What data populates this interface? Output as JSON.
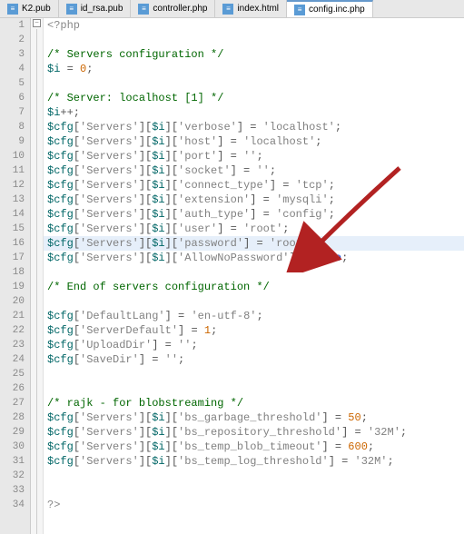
{
  "tabs": [
    {
      "label": "K2.pub",
      "active": false
    },
    {
      "label": "id_rsa.pub",
      "active": false
    },
    {
      "label": "controller.php",
      "active": false
    },
    {
      "label": "index.html",
      "active": false
    },
    {
      "label": "config.inc.php",
      "active": true
    }
  ],
  "gutter": {
    "start": 1,
    "end": 34
  },
  "fold_marker": "−",
  "code_lines": [
    [
      [
        "kw-tag",
        "<?php"
      ]
    ],
    [],
    [
      [
        "kw-cmt",
        "/* Servers configuration */"
      ]
    ],
    [
      [
        "kw-var",
        "$i"
      ],
      [
        "kw-op",
        " = "
      ],
      [
        "kw-num",
        "0"
      ],
      [
        "kw-op",
        ";"
      ]
    ],
    [],
    [
      [
        "kw-cmt",
        "/* Server: localhost [1] */"
      ]
    ],
    [
      [
        "kw-var",
        "$i"
      ],
      [
        "kw-op",
        "++;"
      ]
    ],
    [
      [
        "kw-var",
        "$cfg"
      ],
      [
        "kw-op",
        "["
      ],
      [
        "kw-str",
        "'Servers'"
      ],
      [
        "kw-op",
        "]["
      ],
      [
        "kw-var",
        "$i"
      ],
      [
        "kw-op",
        "]["
      ],
      [
        "kw-str",
        "'verbose'"
      ],
      [
        "kw-op",
        "] = "
      ],
      [
        "kw-str",
        "'localhost'"
      ],
      [
        "kw-op",
        ";"
      ]
    ],
    [
      [
        "kw-var",
        "$cfg"
      ],
      [
        "kw-op",
        "["
      ],
      [
        "kw-str",
        "'Servers'"
      ],
      [
        "kw-op",
        "]["
      ],
      [
        "kw-var",
        "$i"
      ],
      [
        "kw-op",
        "]["
      ],
      [
        "kw-str",
        "'host'"
      ],
      [
        "kw-op",
        "] = "
      ],
      [
        "kw-str",
        "'localhost'"
      ],
      [
        "kw-op",
        ";"
      ]
    ],
    [
      [
        "kw-var",
        "$cfg"
      ],
      [
        "kw-op",
        "["
      ],
      [
        "kw-str",
        "'Servers'"
      ],
      [
        "kw-op",
        "]["
      ],
      [
        "kw-var",
        "$i"
      ],
      [
        "kw-op",
        "]["
      ],
      [
        "kw-str",
        "'port'"
      ],
      [
        "kw-op",
        "] = "
      ],
      [
        "kw-str",
        "''"
      ],
      [
        "kw-op",
        ";"
      ]
    ],
    [
      [
        "kw-var",
        "$cfg"
      ],
      [
        "kw-op",
        "["
      ],
      [
        "kw-str",
        "'Servers'"
      ],
      [
        "kw-op",
        "]["
      ],
      [
        "kw-var",
        "$i"
      ],
      [
        "kw-op",
        "]["
      ],
      [
        "kw-str",
        "'socket'"
      ],
      [
        "kw-op",
        "] = "
      ],
      [
        "kw-str",
        "''"
      ],
      [
        "kw-op",
        ";"
      ]
    ],
    [
      [
        "kw-var",
        "$cfg"
      ],
      [
        "kw-op",
        "["
      ],
      [
        "kw-str",
        "'Servers'"
      ],
      [
        "kw-op",
        "]["
      ],
      [
        "kw-var",
        "$i"
      ],
      [
        "kw-op",
        "]["
      ],
      [
        "kw-str",
        "'connect_type'"
      ],
      [
        "kw-op",
        "] = "
      ],
      [
        "kw-str",
        "'tcp'"
      ],
      [
        "kw-op",
        ";"
      ]
    ],
    [
      [
        "kw-var",
        "$cfg"
      ],
      [
        "kw-op",
        "["
      ],
      [
        "kw-str",
        "'Servers'"
      ],
      [
        "kw-op",
        "]["
      ],
      [
        "kw-var",
        "$i"
      ],
      [
        "kw-op",
        "]["
      ],
      [
        "kw-str",
        "'extension'"
      ],
      [
        "kw-op",
        "] = "
      ],
      [
        "kw-str",
        "'mysqli'"
      ],
      [
        "kw-op",
        ";"
      ]
    ],
    [
      [
        "kw-var",
        "$cfg"
      ],
      [
        "kw-op",
        "["
      ],
      [
        "kw-str",
        "'Servers'"
      ],
      [
        "kw-op",
        "]["
      ],
      [
        "kw-var",
        "$i"
      ],
      [
        "kw-op",
        "]["
      ],
      [
        "kw-str",
        "'auth_type'"
      ],
      [
        "kw-op",
        "] = "
      ],
      [
        "kw-str",
        "'config'"
      ],
      [
        "kw-op",
        ";"
      ]
    ],
    [
      [
        "kw-var",
        "$cfg"
      ],
      [
        "kw-op",
        "["
      ],
      [
        "kw-str",
        "'Servers'"
      ],
      [
        "kw-op",
        "]["
      ],
      [
        "kw-var",
        "$i"
      ],
      [
        "kw-op",
        "]["
      ],
      [
        "kw-str",
        "'user'"
      ],
      [
        "kw-op",
        "] = "
      ],
      [
        "kw-str",
        "'root'"
      ],
      [
        "kw-op",
        ";"
      ]
    ],
    [
      [
        "kw-var",
        "$cfg"
      ],
      [
        "kw-op",
        "["
      ],
      [
        "kw-str",
        "'Servers'"
      ],
      [
        "kw-op",
        "]["
      ],
      [
        "kw-var",
        "$i"
      ],
      [
        "kw-op",
        "]["
      ],
      [
        "kw-str",
        "'password'"
      ],
      [
        "kw-op",
        "] = "
      ],
      [
        "kw-str",
        "'root'"
      ],
      [
        "kw-op",
        ";"
      ]
    ],
    [
      [
        "kw-var",
        "$cfg"
      ],
      [
        "kw-op",
        "["
      ],
      [
        "kw-str",
        "'Servers'"
      ],
      [
        "kw-op",
        "]["
      ],
      [
        "kw-var",
        "$i"
      ],
      [
        "kw-op",
        "]["
      ],
      [
        "kw-str",
        "'AllowNoPassword'"
      ],
      [
        "kw-op",
        "] = "
      ],
      [
        "kw-bool",
        "true"
      ],
      [
        "kw-op",
        ";"
      ]
    ],
    [],
    [
      [
        "kw-cmt",
        "/* End of servers configuration */"
      ]
    ],
    [],
    [
      [
        "kw-var",
        "$cfg"
      ],
      [
        "kw-op",
        "["
      ],
      [
        "kw-str",
        "'DefaultLang'"
      ],
      [
        "kw-op",
        "] = "
      ],
      [
        "kw-str",
        "'en-utf-8'"
      ],
      [
        "kw-op",
        ";"
      ]
    ],
    [
      [
        "kw-var",
        "$cfg"
      ],
      [
        "kw-op",
        "["
      ],
      [
        "kw-str",
        "'ServerDefault'"
      ],
      [
        "kw-op",
        "] = "
      ],
      [
        "kw-num",
        "1"
      ],
      [
        "kw-op",
        ";"
      ]
    ],
    [
      [
        "kw-var",
        "$cfg"
      ],
      [
        "kw-op",
        "["
      ],
      [
        "kw-str",
        "'UploadDir'"
      ],
      [
        "kw-op",
        "] = "
      ],
      [
        "kw-str",
        "''"
      ],
      [
        "kw-op",
        ";"
      ]
    ],
    [
      [
        "kw-var",
        "$cfg"
      ],
      [
        "kw-op",
        "["
      ],
      [
        "kw-str",
        "'SaveDir'"
      ],
      [
        "kw-op",
        "] = "
      ],
      [
        "kw-str",
        "''"
      ],
      [
        "kw-op",
        ";"
      ]
    ],
    [],
    [],
    [
      [
        "kw-cmt",
        "/* rajk - for blobstreaming */"
      ]
    ],
    [
      [
        "kw-var",
        "$cfg"
      ],
      [
        "kw-op",
        "["
      ],
      [
        "kw-str",
        "'Servers'"
      ],
      [
        "kw-op",
        "]["
      ],
      [
        "kw-var",
        "$i"
      ],
      [
        "kw-op",
        "]["
      ],
      [
        "kw-str",
        "'bs_garbage_threshold'"
      ],
      [
        "kw-op",
        "] = "
      ],
      [
        "kw-num",
        "50"
      ],
      [
        "kw-op",
        ";"
      ]
    ],
    [
      [
        "kw-var",
        "$cfg"
      ],
      [
        "kw-op",
        "["
      ],
      [
        "kw-str",
        "'Servers'"
      ],
      [
        "kw-op",
        "]["
      ],
      [
        "kw-var",
        "$i"
      ],
      [
        "kw-op",
        "]["
      ],
      [
        "kw-str",
        "'bs_repository_threshold'"
      ],
      [
        "kw-op",
        "] = "
      ],
      [
        "kw-str",
        "'32M'"
      ],
      [
        "kw-op",
        ";"
      ]
    ],
    [
      [
        "kw-var",
        "$cfg"
      ],
      [
        "kw-op",
        "["
      ],
      [
        "kw-str",
        "'Servers'"
      ],
      [
        "kw-op",
        "]["
      ],
      [
        "kw-var",
        "$i"
      ],
      [
        "kw-op",
        "]["
      ],
      [
        "kw-str",
        "'bs_temp_blob_timeout'"
      ],
      [
        "kw-op",
        "] = "
      ],
      [
        "kw-num",
        "600"
      ],
      [
        "kw-op",
        ";"
      ]
    ],
    [
      [
        "kw-var",
        "$cfg"
      ],
      [
        "kw-op",
        "["
      ],
      [
        "kw-str",
        "'Servers'"
      ],
      [
        "kw-op",
        "]["
      ],
      [
        "kw-var",
        "$i"
      ],
      [
        "kw-op",
        "]["
      ],
      [
        "kw-str",
        "'bs_temp_log_threshold'"
      ],
      [
        "kw-op",
        "] = "
      ],
      [
        "kw-str",
        "'32M'"
      ],
      [
        "kw-op",
        ";"
      ]
    ],
    [],
    [],
    [
      [
        "kw-php",
        "?>"
      ]
    ]
  ],
  "highlight_line_index": 15,
  "arrow_color": "#b22222"
}
